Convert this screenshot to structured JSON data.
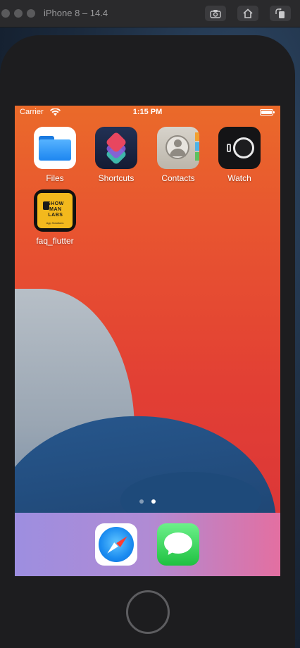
{
  "window": {
    "title": "iPhone 8 – 14.4",
    "toolbar": {
      "screenshot_icon": "camera-icon",
      "home_icon": "home-icon",
      "rotate_icon": "rotate-icon"
    }
  },
  "status_bar": {
    "carrier": "Carrier",
    "time": "1:15 PM"
  },
  "home_screen": {
    "apps": [
      {
        "label": "Files",
        "icon": "files-icon"
      },
      {
        "label": "Shortcuts",
        "icon": "shortcuts-icon"
      },
      {
        "label": "Contacts",
        "icon": "contacts-icon"
      },
      {
        "label": "Watch",
        "icon": "watch-icon"
      },
      {
        "label": "faq_flutter",
        "icon": "faq-flutter-icon",
        "logo_text": "SHOW\nMAN\nLABS",
        "logo_sub": "App Solutions"
      }
    ],
    "page_indicator": {
      "pages": 2,
      "current": 2
    }
  },
  "dock": {
    "apps": [
      {
        "name": "Safari",
        "icon": "safari-icon"
      },
      {
        "name": "Messages",
        "icon": "messages-icon"
      }
    ]
  },
  "colors": {
    "wallpaper_orange": "#ea6a2a",
    "wallpaper_red": "#d9333a",
    "wallpaper_blue": "#26558a",
    "dock_start": "#9d8ee0",
    "dock_end": "#e36fa1"
  }
}
